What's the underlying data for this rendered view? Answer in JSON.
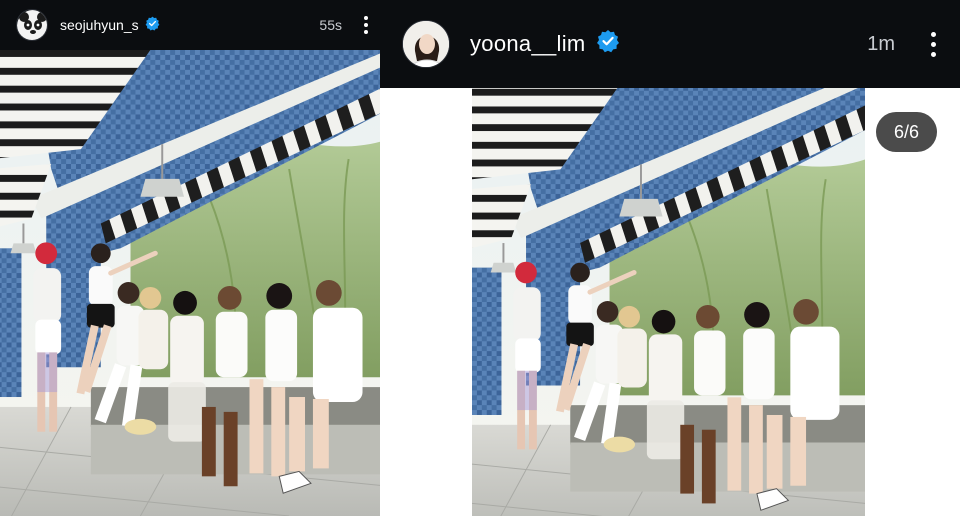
{
  "left_story": {
    "username": "seojuhyun_s",
    "time": "55s",
    "avatar_icon": "panda-avatar-icon",
    "verified_icon": "verified-badge-icon"
  },
  "right_story": {
    "username": "yoona__lim",
    "time": "1m",
    "avatar_icon": "profile-avatar-icon",
    "verified_icon": "verified-badge-icon",
    "page_counter": "6/6"
  },
  "colors": {
    "header_bg": "#0b0d10",
    "verified_blue": "#1d9bf0",
    "counter_bg": "#4b4b4b",
    "tile_blue": "#3f6fa6"
  }
}
